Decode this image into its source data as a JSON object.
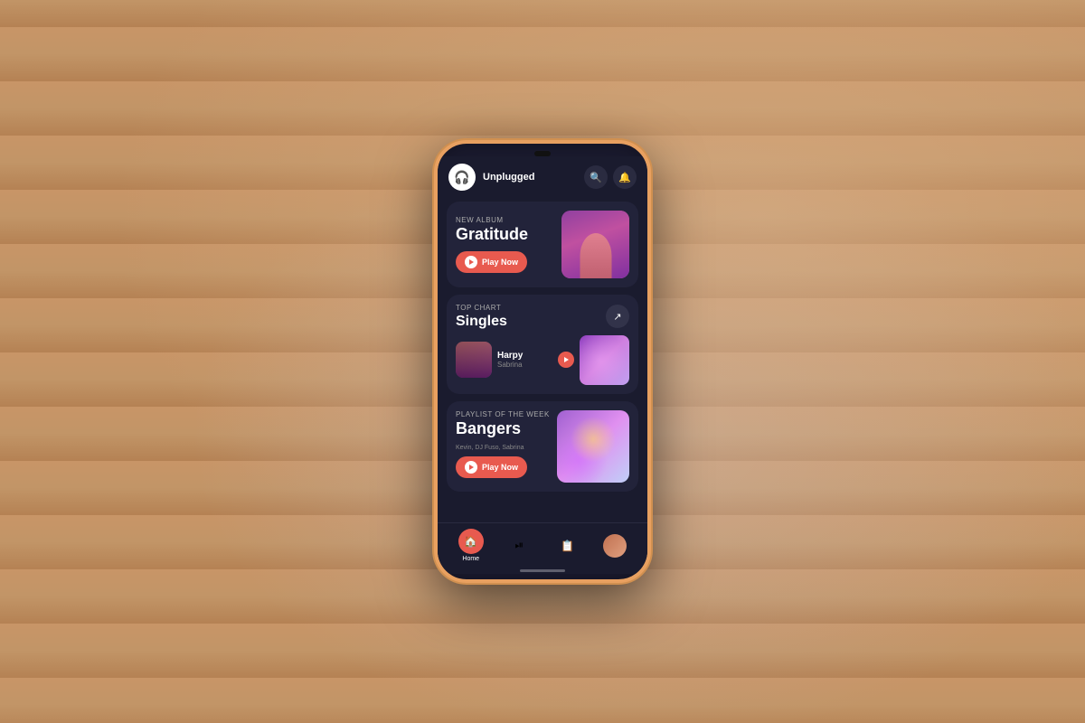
{
  "app": {
    "name": "Unplugged",
    "logo_icon": "🎧"
  },
  "header": {
    "search_icon": "🔍",
    "notification_icon": "🔔"
  },
  "sections": {
    "new_album": {
      "label": "New Album",
      "title": "Gratitude",
      "play_label": "Play Now"
    },
    "top_chart": {
      "label": "Top Chart",
      "title": "Singles",
      "song": {
        "name": "Harpy",
        "artist": "Sabrina"
      }
    },
    "playlist": {
      "label": "Playlist of The Week",
      "title": "Bangers",
      "artists": "Kevin, DJ Fuso, Sabrina",
      "play_label": "Play Now"
    }
  },
  "nav": {
    "items": [
      {
        "icon": "🏠",
        "label": "Home",
        "active": true
      },
      {
        "icon": "▶",
        "label": "",
        "active": false
      },
      {
        "icon": "≡+",
        "label": "",
        "active": false
      },
      {
        "icon": "👤",
        "label": "",
        "active": false
      }
    ]
  }
}
